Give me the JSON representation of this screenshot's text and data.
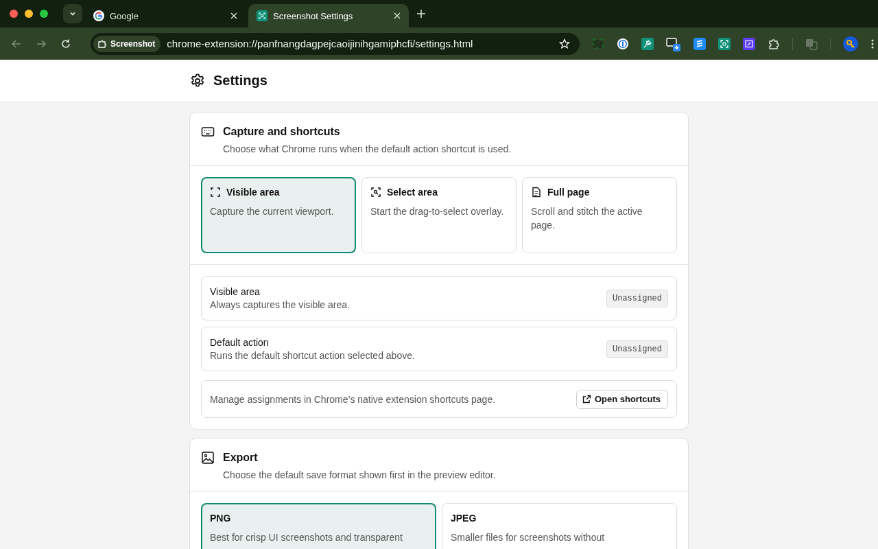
{
  "browser": {
    "tabs": [
      {
        "title": "Google",
        "selected": false
      },
      {
        "title": "Screenshot Settings",
        "selected": true
      }
    ],
    "address": {
      "chip": "Screenshot",
      "url": "chrome-extension://panfnangdagpejcaoijinihgamiphcfi/settings.html"
    }
  },
  "page": {
    "title": "Settings"
  },
  "sections": [
    {
      "title": "Capture and shortcuts",
      "description": "Choose what Chrome runs when the default action shortcut is used.",
      "options": [
        {
          "title": "Visible area",
          "description": "Capture the current viewport.",
          "selected": true
        },
        {
          "title": "Select area",
          "description": "Start the drag-to-select overlay.",
          "selected": false
        },
        {
          "title": "Full page",
          "description": "Scroll and stitch the active page.",
          "selected": false
        }
      ],
      "shortcuts": [
        {
          "name": "Visible area",
          "description": "Always captures the visible area.",
          "key": "Unassigned"
        },
        {
          "name": "Default action",
          "description": "Runs the default shortcut action selected above.",
          "key": "Unassigned"
        }
      ],
      "manage": {
        "text": "Manage assignments in Chrome’s native extension shortcuts page.",
        "button": "Open shortcuts"
      }
    },
    {
      "title": "Export",
      "description": "Choose the default save format shown first in the preview editor.",
      "options": [
        {
          "title": "PNG",
          "description": "Best for crisp UI screenshots and transparent",
          "selected": true
        },
        {
          "title": "JPEG",
          "description": "Smaller files for screenshots without",
          "selected": false
        }
      ]
    }
  ]
}
